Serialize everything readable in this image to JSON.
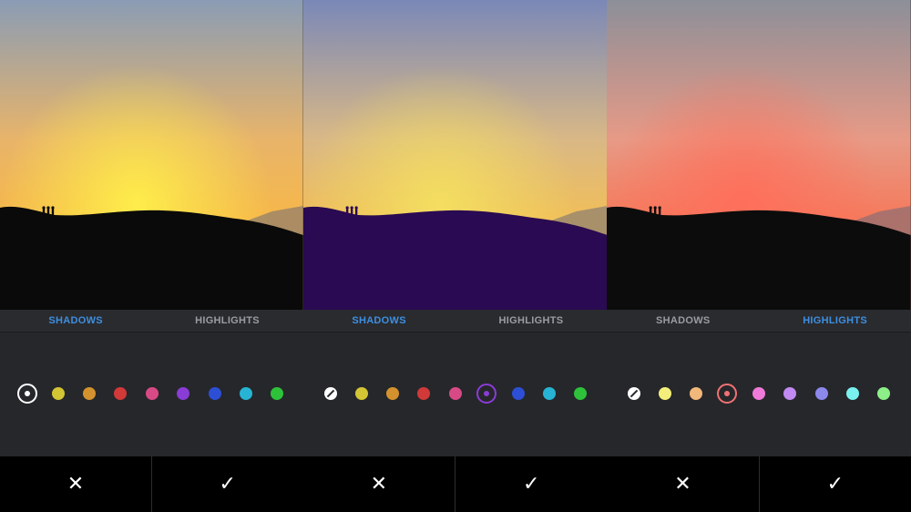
{
  "panels": [
    {
      "tabs": [
        {
          "label": "SHADOWS",
          "active": true
        },
        {
          "label": "HIGHLIGHTS",
          "active": false
        }
      ],
      "sky": {
        "top": "#8a9cb5",
        "mid": "#e8b46a",
        "glow": "#fff04a",
        "horizon": "#f6b74a"
      },
      "ground_tint": "#0a0a0a",
      "swatches": [
        {
          "name": "none",
          "color": "#ffffff",
          "selected": true
        },
        {
          "name": "yellow",
          "color": "#d4c534"
        },
        {
          "name": "orange",
          "color": "#d4922e"
        },
        {
          "name": "red",
          "color": "#d23939"
        },
        {
          "name": "pink",
          "color": "#d84a86"
        },
        {
          "name": "purple",
          "color": "#8a3cd6"
        },
        {
          "name": "blue",
          "color": "#2c4fd6"
        },
        {
          "name": "cyan",
          "color": "#27b4d4"
        },
        {
          "name": "green",
          "color": "#2ec23b"
        }
      ],
      "actions": {
        "cancel": "✕",
        "confirm": "✓"
      }
    },
    {
      "tabs": [
        {
          "label": "SHADOWS",
          "active": true
        },
        {
          "label": "HIGHLIGHTS",
          "active": false
        }
      ],
      "sky": {
        "top": "#7a88b8",
        "mid": "#d9b886",
        "glow": "#f4e060",
        "horizon": "#f0be5a"
      },
      "ground_tint": "#2a0a52",
      "swatches": [
        {
          "name": "none",
          "color": "#ffffff"
        },
        {
          "name": "yellow",
          "color": "#d4c534"
        },
        {
          "name": "orange",
          "color": "#d4922e"
        },
        {
          "name": "red",
          "color": "#d23939"
        },
        {
          "name": "pink",
          "color": "#d84a86"
        },
        {
          "name": "purple",
          "color": "#8a3cd6",
          "selected": true
        },
        {
          "name": "blue",
          "color": "#2c4fd6"
        },
        {
          "name": "cyan",
          "color": "#27b4d4"
        },
        {
          "name": "green",
          "color": "#2ec23b"
        }
      ],
      "actions": {
        "cancel": "✕",
        "confirm": "✓"
      }
    },
    {
      "tabs": [
        {
          "label": "SHADOWS",
          "active": false
        },
        {
          "label": "HIGHLIGHTS",
          "active": true
        }
      ],
      "sky": {
        "top": "#8c8f99",
        "mid": "#e79a86",
        "glow": "#ff6e5a",
        "horizon": "#f57a5c"
      },
      "ground_tint": "#0c0c0c",
      "swatches": [
        {
          "name": "none",
          "color": "#ffffff"
        },
        {
          "name": "yellow",
          "color": "#f3ef7a"
        },
        {
          "name": "orange",
          "color": "#f2b77a"
        },
        {
          "name": "red",
          "color": "#f07272",
          "selected": true
        },
        {
          "name": "pink",
          "color": "#f07ad9"
        },
        {
          "name": "purple",
          "color": "#c08af2"
        },
        {
          "name": "blue",
          "color": "#8c88ec"
        },
        {
          "name": "cyan",
          "color": "#7af0ef"
        },
        {
          "name": "green",
          "color": "#8cef88"
        }
      ],
      "actions": {
        "cancel": "✕",
        "confirm": "✓"
      }
    }
  ]
}
